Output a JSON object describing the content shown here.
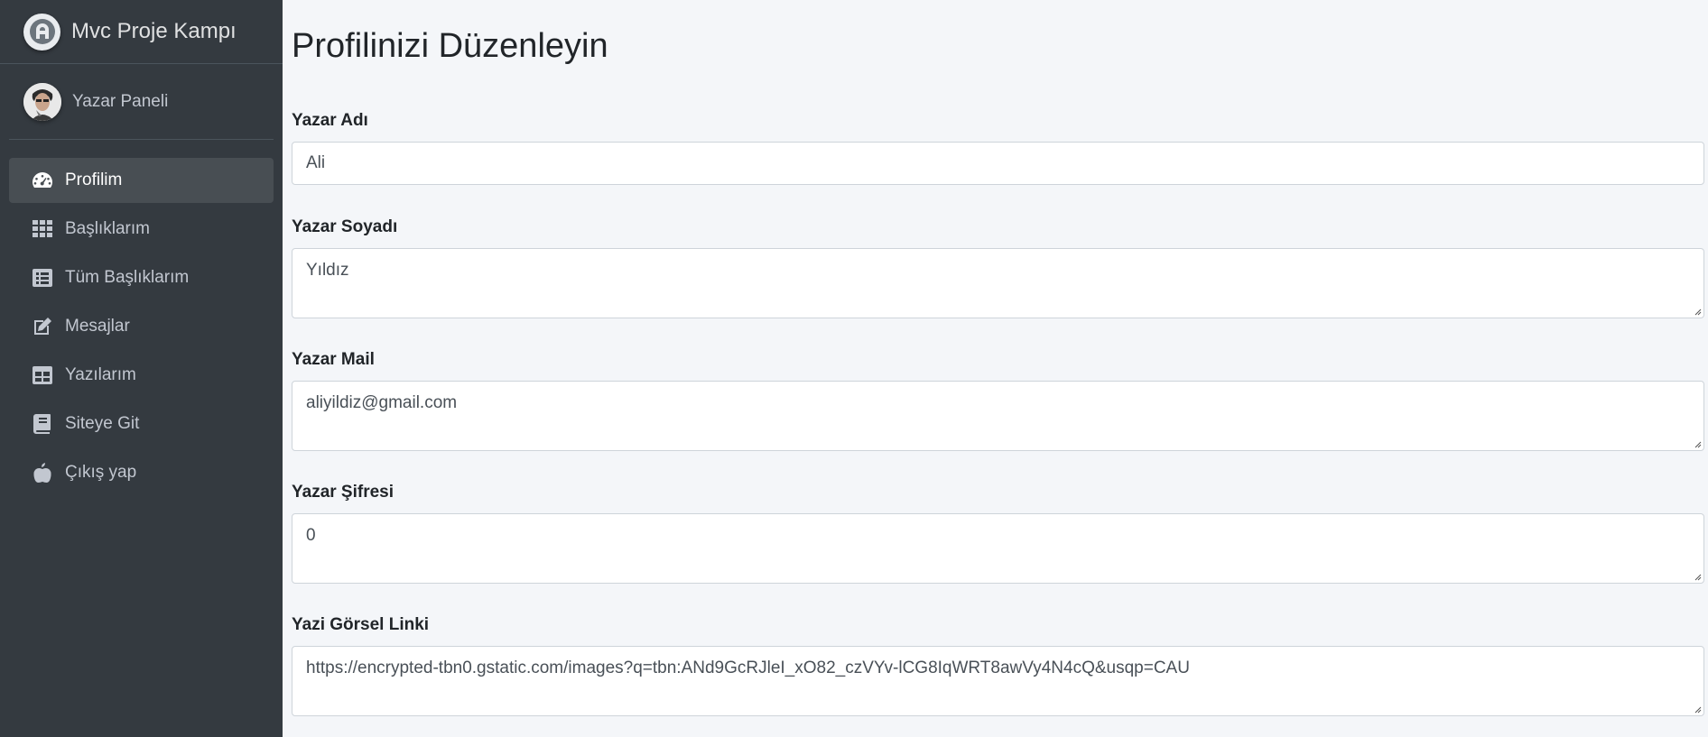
{
  "brand": {
    "title": "Mvc Proje Kampı"
  },
  "user": {
    "name": "Yazar Paneli"
  },
  "sidebar": {
    "items": [
      {
        "label": "Profilim",
        "icon": "tachometer-icon",
        "active": true
      },
      {
        "label": "Başlıklarım",
        "icon": "grid-icon",
        "active": false
      },
      {
        "label": "Tüm Başlıklarım",
        "icon": "list-icon",
        "active": false
      },
      {
        "label": "Mesajlar",
        "icon": "edit-icon",
        "active": false
      },
      {
        "label": "Yazılarım",
        "icon": "table-icon",
        "active": false
      },
      {
        "label": "Siteye Git",
        "icon": "book-icon",
        "active": false
      },
      {
        "label": "Çıkış yap",
        "icon": "apple-icon",
        "active": false
      }
    ]
  },
  "main": {
    "title": "Profilinizi Düzenleyin",
    "fields": {
      "first_name": {
        "label": "Yazar Adı",
        "value": "Ali"
      },
      "last_name": {
        "label": "Yazar Soyadı",
        "value": "Yıldız"
      },
      "mail": {
        "label": "Yazar Mail",
        "value": "aliyildiz@gmail.com"
      },
      "password": {
        "label": "Yazar Şifresi",
        "value": "0"
      },
      "image_link": {
        "label": "Yazi Görsel Linki",
        "value": "https://encrypted-tbn0.gstatic.com/images?q=tbn:ANd9GcRJleI_xO82_czVYv-lCG8IqWRT8awVy4N4cQ&usqp=CAU"
      }
    }
  },
  "colors": {
    "sidebar_bg": "#343a40",
    "content_bg": "#f4f6f9",
    "sidebar_text": "#c2c7d0"
  }
}
